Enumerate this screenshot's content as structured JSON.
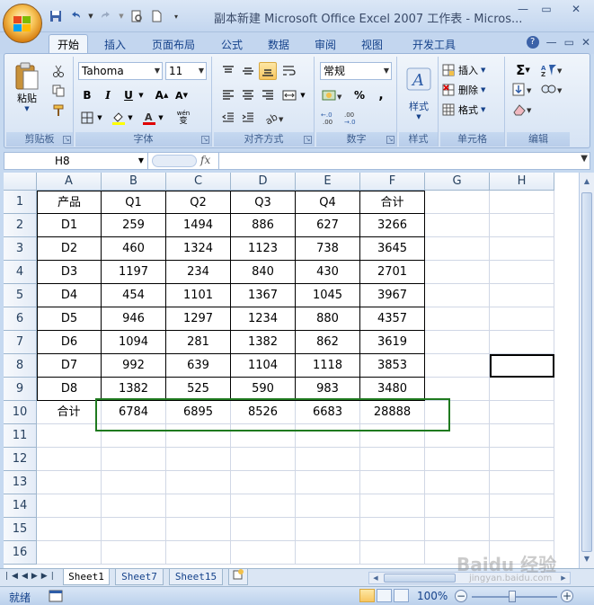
{
  "window": {
    "title": "副本新建 Microsoft Office Excel 2007 工作表 - Micros..."
  },
  "ribbon_tabs": [
    "开始",
    "插入",
    "页面布局",
    "公式",
    "数据",
    "审阅",
    "视图",
    "开发工具"
  ],
  "ribbon": {
    "clipboard": {
      "label": "剪贴板",
      "paste": "粘贴"
    },
    "font": {
      "label": "字体",
      "font_name": "Tahoma",
      "font_size": "11",
      "wen": "wén\n变"
    },
    "alignment": {
      "label": "对齐方式"
    },
    "number": {
      "label": "数字",
      "format": "常规",
      "percent": "%",
      "comma": ","
    },
    "styles": {
      "label": "样式"
    },
    "cells": {
      "label": "单元格",
      "insert": "插入",
      "delete": "删除",
      "format": "格式"
    },
    "editing": {
      "label": "编辑"
    }
  },
  "formula_bar": {
    "name_box": "H8",
    "fx": "fx",
    "content": ""
  },
  "columns": [
    "A",
    "B",
    "C",
    "D",
    "E",
    "F",
    "G",
    "H"
  ],
  "rows": [
    "1",
    "2",
    "3",
    "4",
    "5",
    "6",
    "7",
    "8",
    "9",
    "10",
    "11",
    "12",
    "13",
    "14",
    "15",
    "16"
  ],
  "table": {
    "header": [
      "产品",
      "Q1",
      "Q2",
      "Q3",
      "Q4",
      "合计"
    ],
    "body": [
      [
        "D1",
        "259",
        "1494",
        "886",
        "627",
        "3266"
      ],
      [
        "D2",
        "460",
        "1324",
        "1123",
        "738",
        "3645"
      ],
      [
        "D3",
        "1197",
        "234",
        "840",
        "430",
        "2701"
      ],
      [
        "D4",
        "454",
        "1101",
        "1367",
        "1045",
        "3967"
      ],
      [
        "D5",
        "946",
        "1297",
        "1234",
        "880",
        "4357"
      ],
      [
        "D6",
        "1094",
        "281",
        "1382",
        "862",
        "3619"
      ],
      [
        "D7",
        "992",
        "639",
        "1104",
        "1118",
        "3853"
      ],
      [
        "D8",
        "1382",
        "525",
        "590",
        "983",
        "3480"
      ]
    ],
    "total": [
      "合计",
      "6784",
      "6895",
      "8526",
      "6683",
      "28888"
    ]
  },
  "sheet_tabs": [
    "Sheet1",
    "Sheet7",
    "Sheet15"
  ],
  "active_sheet": "Sheet1",
  "status": {
    "ready": "就绪",
    "zoom": "100%"
  },
  "watermark": {
    "main": "Baidu 经验",
    "sub": "jingyan.baidu.com"
  },
  "colors": {
    "highlight_box": "#1f7a1f",
    "ribbon_bg": "#d6e3f4",
    "header_text": "#15428b"
  }
}
